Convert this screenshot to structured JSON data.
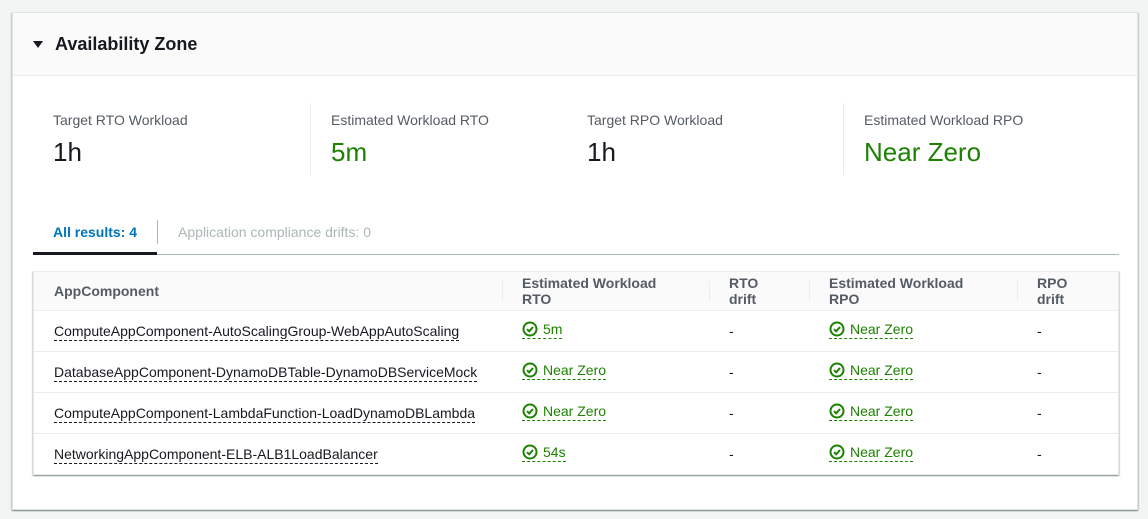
{
  "section": {
    "title": "Availability Zone",
    "expanded": true
  },
  "kpis": [
    {
      "label": "Target RTO Workload",
      "value": "1h",
      "status": "neutral"
    },
    {
      "label": "Estimated Workload RTO",
      "value": "5m",
      "status": "success"
    },
    {
      "label": "Target RPO Workload",
      "value": "1h",
      "status": "neutral"
    },
    {
      "label": "Estimated Workload RPO",
      "value": "Near Zero",
      "status": "success"
    }
  ],
  "tabs": [
    {
      "label": "All results: 4",
      "active": true
    },
    {
      "label": "Application compliance drifts: 0",
      "active": false
    }
  ],
  "table": {
    "columns": [
      "AppComponent",
      "Estimated Workload RTO",
      "RTO drift",
      "Estimated Workload RPO",
      "RPO drift"
    ],
    "rows": [
      {
        "component": "ComputeAppComponent-AutoScalingGroup-WebAppAutoScaling",
        "rto": "5m",
        "rto_drift": "-",
        "rpo": "Near Zero",
        "rpo_drift": "-"
      },
      {
        "component": "DatabaseAppComponent-DynamoDBTable-DynamoDBServiceMock",
        "rto": "Near Zero",
        "rto_drift": "-",
        "rpo": "Near Zero",
        "rpo_drift": "-"
      },
      {
        "component": "ComputeAppComponent-LambdaFunction-LoadDynamoDBLambda",
        "rto": "Near Zero",
        "rto_drift": "-",
        "rpo": "Near Zero",
        "rpo_drift": "-"
      },
      {
        "component": "NetworkingAppComponent-ELB-ALB1LoadBalancer",
        "rto": "54s",
        "rto_drift": "-",
        "rpo": "Near Zero",
        "rpo_drift": "-"
      }
    ]
  },
  "icons": {
    "caret": "caret-down-icon",
    "status": "status-success-check-circle-icon"
  },
  "colors": {
    "success": "#1d8102",
    "link_active": "#0073bb",
    "text": "#16191f",
    "muted": "#545b64"
  }
}
